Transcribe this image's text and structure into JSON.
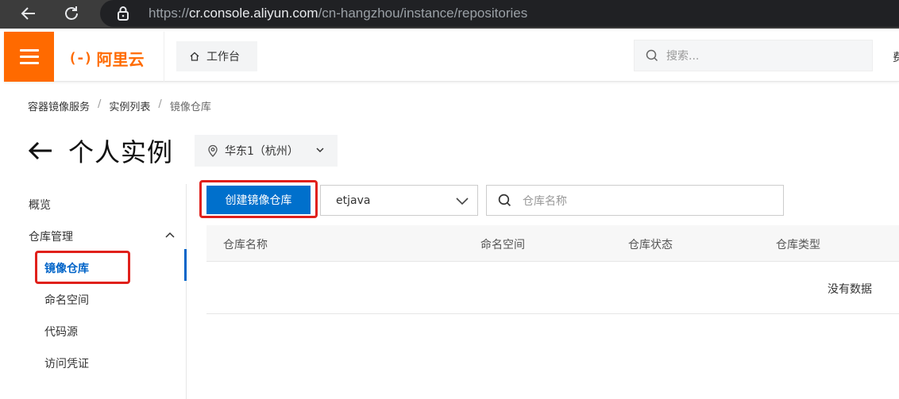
{
  "browser": {
    "url_host": "cr.console.aliyun.com",
    "url_scheme": "https://",
    "url_path": "/cn-hangzhou/instance/repositories"
  },
  "header": {
    "logo_text": "阿里云",
    "logo_mark": "(-)",
    "workbench_label": "工作台",
    "search_placeholder": "搜索...",
    "truncated_right_text": "费"
  },
  "breadcrumb": {
    "items": [
      "容器镜像服务",
      "实例列表",
      "镜像仓库"
    ],
    "separator": "/"
  },
  "page": {
    "title": "个人实例",
    "region": "华东1（杭州）"
  },
  "sidebar": {
    "overview": "概览",
    "group_label": "仓库管理",
    "items": [
      "镜像仓库",
      "命名空间",
      "代码源",
      "访问凭证"
    ]
  },
  "toolbar": {
    "create_label": "创建镜像仓库",
    "namespace_value": "etjava",
    "search_placeholder": "仓库名称"
  },
  "table": {
    "columns": [
      "仓库名称",
      "命名空间",
      "仓库状态",
      "仓库类型"
    ],
    "empty_text": "没有数据"
  },
  "colors": {
    "brand": "#ff6a00",
    "primary": "#0070cc",
    "highlight": "#e0201b"
  }
}
